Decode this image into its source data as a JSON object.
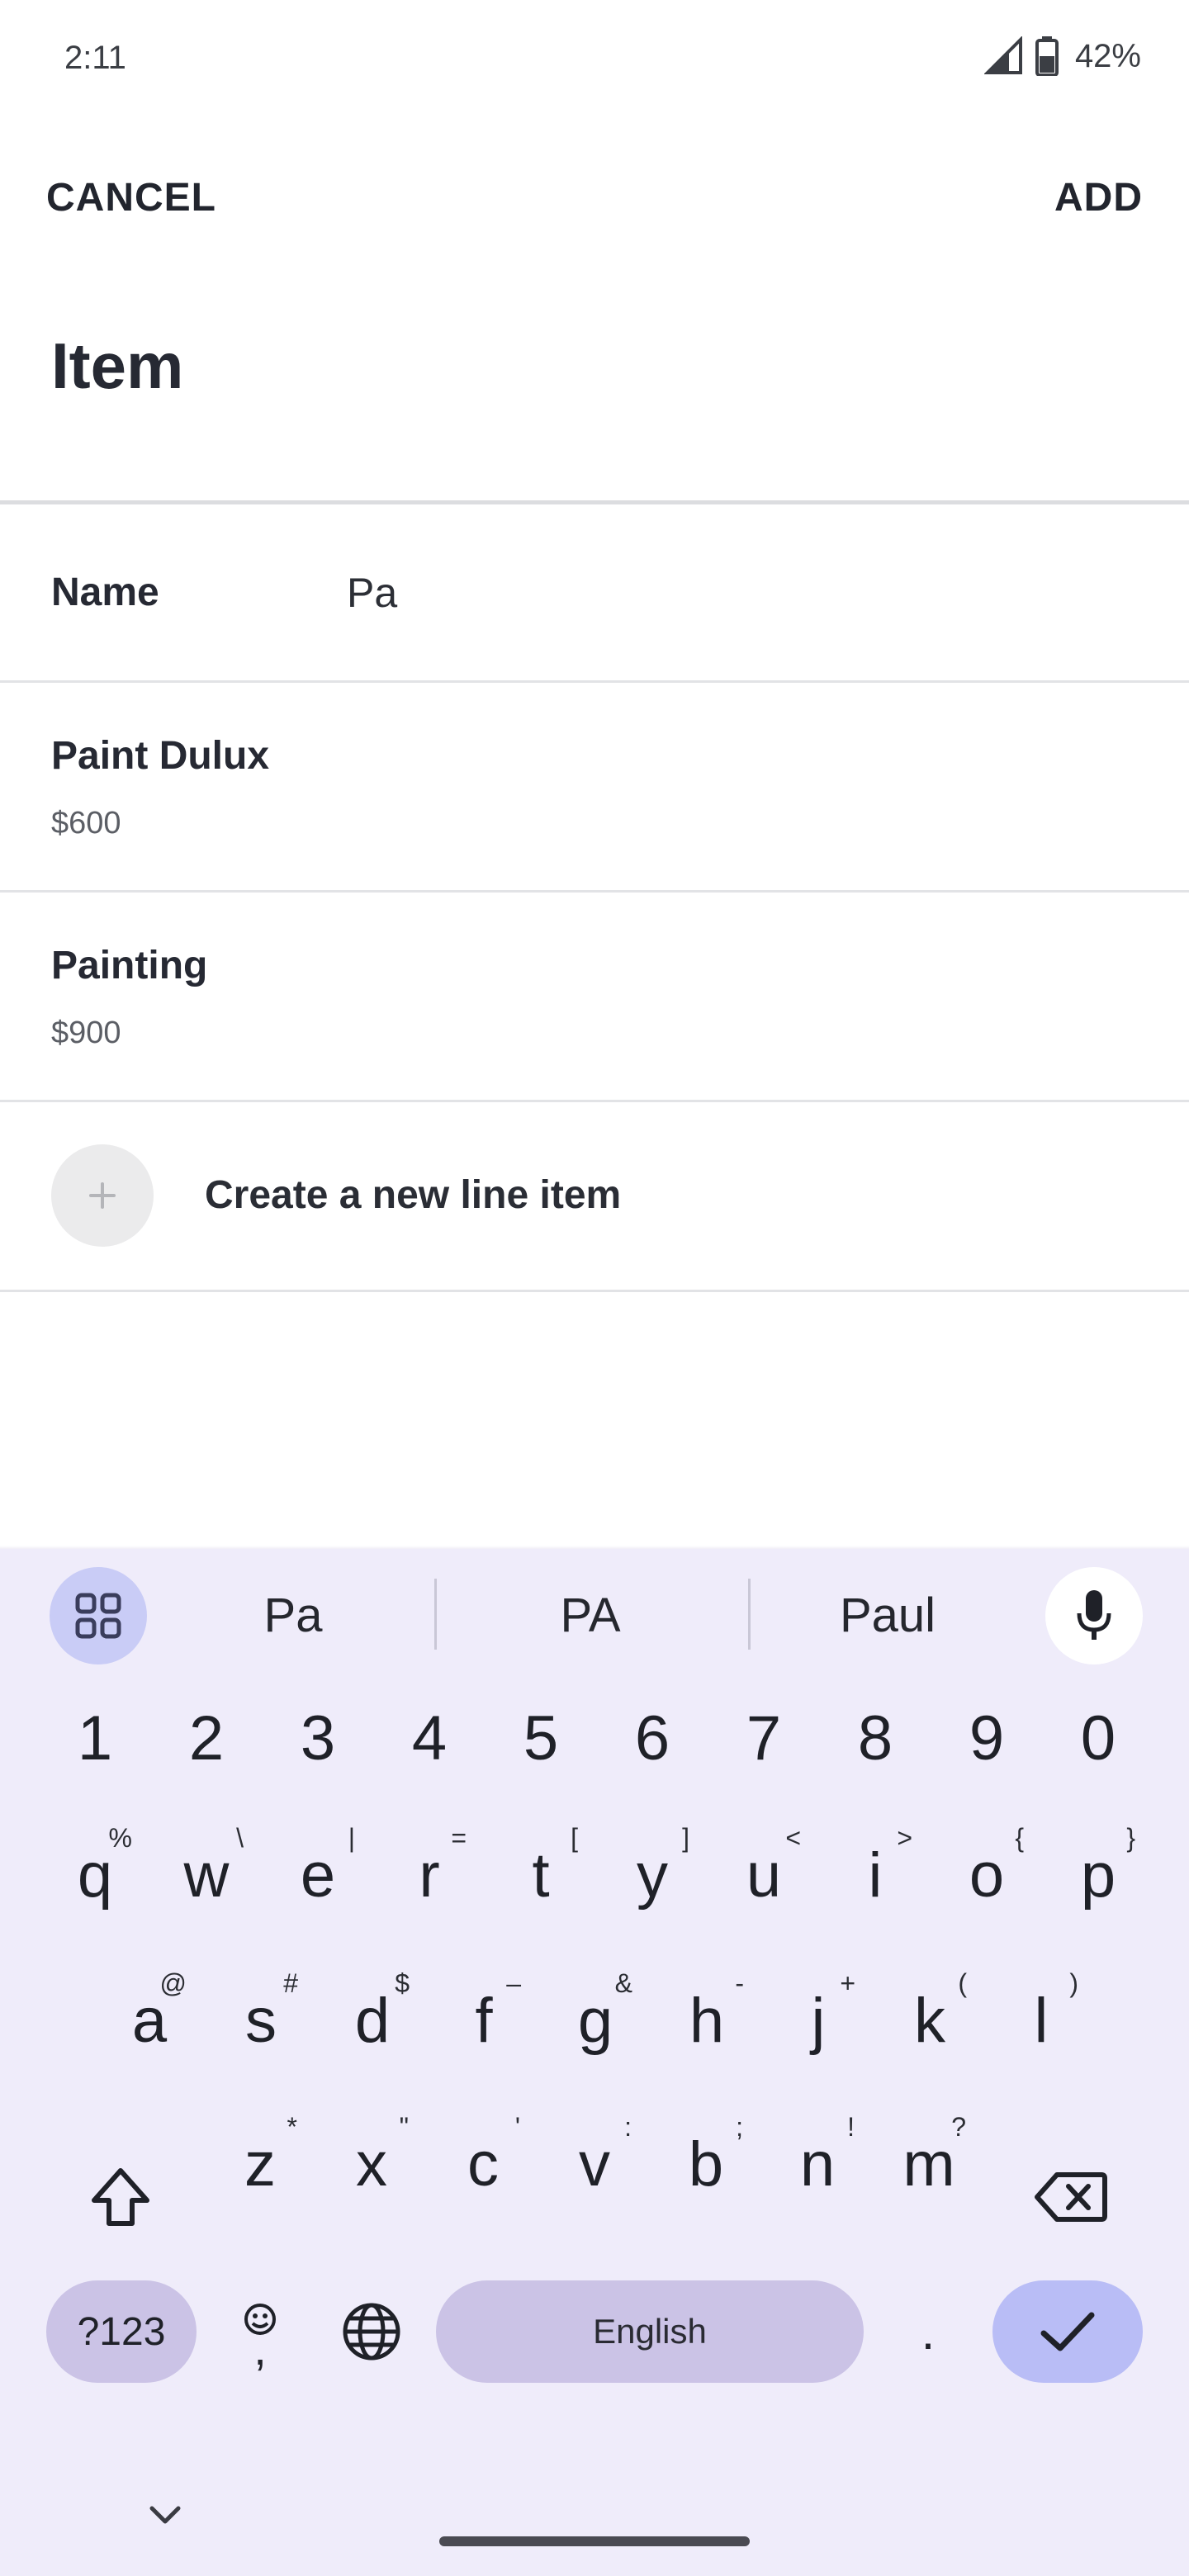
{
  "status_bar": {
    "time": "2:11",
    "battery": "42%",
    "signal_icon": "signal-icon",
    "battery_icon": "battery-icon"
  },
  "header": {
    "cancel_label": "CANCEL",
    "add_label": "ADD",
    "title": "Item"
  },
  "form": {
    "name_label": "Name",
    "name_value": "Pa"
  },
  "results": [
    {
      "name": "Paint Dulux",
      "price": "$600"
    },
    {
      "name": "Painting",
      "price": "$900"
    }
  ],
  "create": {
    "label": "Create a new line item",
    "icon": "plus-icon"
  },
  "keyboard": {
    "suggestions": [
      "Pa",
      "PA",
      "Paul"
    ],
    "number_row": [
      "1",
      "2",
      "3",
      "4",
      "5",
      "6",
      "7",
      "8",
      "9",
      "0"
    ],
    "row1": [
      {
        "k": "q",
        "s": "%"
      },
      {
        "k": "w",
        "s": "\\"
      },
      {
        "k": "e",
        "s": "|"
      },
      {
        "k": "r",
        "s": "="
      },
      {
        "k": "t",
        "s": "["
      },
      {
        "k": "y",
        "s": "]"
      },
      {
        "k": "u",
        "s": "<"
      },
      {
        "k": "i",
        "s": ">"
      },
      {
        "k": "o",
        "s": "{"
      },
      {
        "k": "p",
        "s": "}"
      }
    ],
    "row2": [
      {
        "k": "a",
        "s": "@"
      },
      {
        "k": "s",
        "s": "#"
      },
      {
        "k": "d",
        "s": "$"
      },
      {
        "k": "f",
        "s": "–"
      },
      {
        "k": "g",
        "s": "&"
      },
      {
        "k": "h",
        "s": "-"
      },
      {
        "k": "j",
        "s": "+"
      },
      {
        "k": "k",
        "s": "("
      },
      {
        "k": "l",
        "s": ")"
      }
    ],
    "row3": [
      {
        "k": "z",
        "s": "*"
      },
      {
        "k": "x",
        "s": "\""
      },
      {
        "k": "c",
        "s": "'"
      },
      {
        "k": "v",
        "s": ":"
      },
      {
        "k": "b",
        "s": ";"
      },
      {
        "k": "n",
        "s": "!"
      },
      {
        "k": "m",
        "s": "?"
      }
    ],
    "symbols_label": "?123",
    "emoji_comma": ",",
    "space_label": "English",
    "period_label": ".",
    "accent_color": "#b9bdf6",
    "background_color": "#efecfa"
  }
}
